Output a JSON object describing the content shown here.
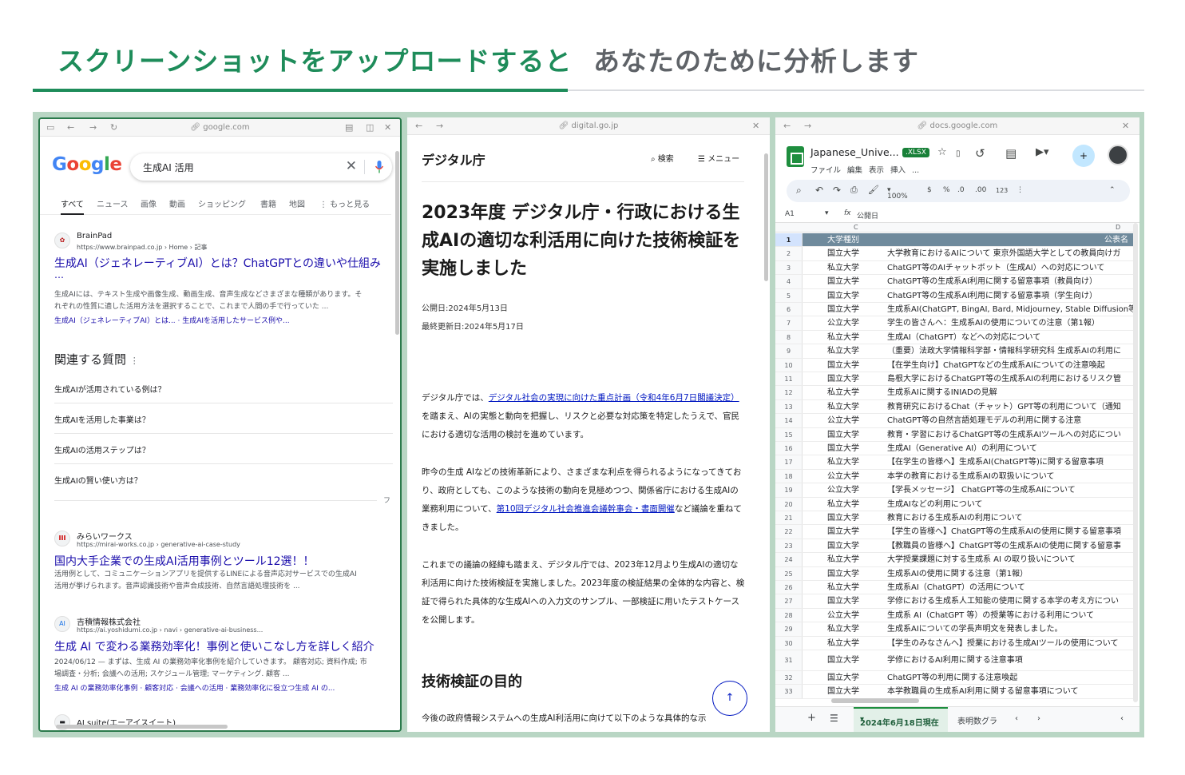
{
  "header": {
    "active_tab": "スクリーンショットをアップロードすると",
    "inactive_tab": "あなたのために分析します"
  },
  "panel_google": {
    "url": "google.com",
    "logo": [
      "G",
      "o",
      "o",
      "g",
      "l",
      "e"
    ],
    "query": "生成AI 活用",
    "nav": [
      "すべて",
      "ニュース",
      "画像",
      "動画",
      "ショッピング",
      "書籍",
      "地図",
      "⋮ もっと見る"
    ],
    "results": [
      {
        "site": "BrainPad",
        "crumb": "https://www.brainpad.co.jp › Home › 記事",
        "title": "生成AI（ジェネレーティブAI）とは？ChatGPTとの違いや仕組み",
        "ellipsis": "…",
        "snippet1": "生成AIには、テキスト生成や画像生成、動画生成、音声生成などさまざまな種類があります。そ",
        "snippet2": "れぞれの性質に適した活用方法を選択することで、これまで人間の手で行っていた ...",
        "links": "生成AI（ジェネレーティブAI）とは... · 生成AIを活用したサービス例や..."
      },
      {
        "site": "みらいワークス",
        "crumb": "https://mirai-works.co.jp › generative-ai-case-study",
        "title": "国内大手企業での生成AI活用事例とツール12選！！",
        "snippet1": "活用例として、コミュニケーションアプリを提供するLINEによる音声応対サービスでの生成AI",
        "snippet2": "活用が挙げられます。音声認識技術や音声合成技術、自然言語処理技術を ..."
      },
      {
        "site": "吉積情報株式会社",
        "crumb": "https://ai.yoshidumi.co.jp › navi › generative-ai-business...",
        "title": "生成 AI で変わる業務効率化！事例と使いこなし方を詳しく紹介",
        "snippet1": "2024/06/12 — まずは、生成 AI の業務効率化事例を紹介していきます。 顧客対応; 資料作成; 市",
        "snippet2": "場調査・分析; 会議への活用; スケジュール管理; マーケティング. 顧客 ...",
        "links": "生成 AI の業務効率化事例 · 顧客対応 · 会議への活用 · 業務効率化に役立つ生成 AI の..."
      },
      {
        "site": "AI suite(エーアイスイート)"
      }
    ],
    "paa_title": "関連する質問",
    "paa": [
      "生成AIが活用されている例は？",
      "生成AIを活用した事業は？",
      "生成AIの活用ステップは？",
      "生成AIの賢い使い方は？"
    ],
    "feedback": "フ"
  },
  "panel_digital": {
    "url": "digital.go.jp",
    "site_name": "デジタル庁",
    "search_label": "検索",
    "menu_label": "メニュー",
    "title": "2023年度 デジタル庁・行政における生成AIの適切な利活用に向けた技術検証を実施しました",
    "published": "公開日:2024年5月13日",
    "updated": "最終更新日:2024年5月17日",
    "p1_a": "デジタル庁では、",
    "p1_link": "デジタル社会の実現に向けた重点計画（令和4年6月7日閣議決定）",
    "p1_b": "を踏まえ、AIの実態と動向を把握し、リスクと必要な対応策を特定したうえで、官民における適切な活用の検討を進めています。",
    "p2_a": "昨今の生成 AIなどの技術革新により、さまざまな利点を得られるようになってきており、政府としても、このような技術の動向を見極めつつ、関係省庁における生成AIの業務利用について、",
    "p2_link": "第10回デジタル社会推進会議幹事会・書面開催",
    "p2_b": "など議論を重ねてきました。",
    "p3": "これまでの議論の経緯も踏まえ、デジタル庁では、2023年12月より生成AIの適切な利活用に向けた技術検証を実施しました。2023年度の検証結果の全体的な内容と、検証で得られた具体的な生成AIへの入力文のサンプル、一部検証に用いたテストケースを公開します。",
    "h2": "技術検証の目的",
    "last_line": "今後の政府情報システムへの生成AI利活用に向けて以下のような具体的な示"
  },
  "panel_sheets": {
    "url": "docs.google.com",
    "doc_name": "Japanese_Unive...",
    "badge": ".XLSX",
    "menu": [
      "ファイル",
      "編集",
      "表示",
      "挿入",
      "..."
    ],
    "zoom": "100%",
    "toolbar_items": [
      "$",
      "%",
      ".0",
      ".00",
      "123"
    ],
    "cell_ref": "A1",
    "formula": "公開日",
    "col_c": "C",
    "col_d": "D",
    "rows": [
      {
        "n": "1",
        "a": "大学種別",
        "b": "公表名"
      },
      {
        "n": "2",
        "a": "国立大学",
        "b": "大学教育におけるAIについて 東京外国語大学としての教員向けガ"
      },
      {
        "n": "3",
        "a": "私立大学",
        "b": "ChatGPT等のAIチャットボット（生成AI）への対応について"
      },
      {
        "n": "4",
        "a": "国立大学",
        "b": "ChatGPT等の生成系AI利用に関する留意事項（教員向け）"
      },
      {
        "n": "5",
        "a": "国立大学",
        "b": "ChatGPT等の生成系AI利用に関する留意事項（学生向け）"
      },
      {
        "n": "6",
        "a": "国立大学",
        "b": "生成系AI(ChatGPT, BingAI, Bard, Midjourney, Stable Diffusion等)"
      },
      {
        "n": "7",
        "a": "公立大学",
        "b": "学生の皆さんへ：生成系AIの使用についての注意（第1報）"
      },
      {
        "n": "8",
        "a": "私立大学",
        "b": "生成AI（ChatGPT）などへの対応について"
      },
      {
        "n": "9",
        "a": "私立大学",
        "b": "（重要）法政大学情報科学部・情報科学研究科 生成系AIの利用に"
      },
      {
        "n": "10",
        "a": "国立大学",
        "b": "【在学生向け】ChatGPTなどの生成系AIについての注意喚起"
      },
      {
        "n": "11",
        "a": "国立大学",
        "b": "島根大学におけるChatGPT等の生成系AIの利用におけるリスク管"
      },
      {
        "n": "12",
        "a": "私立大学",
        "b": "生成系AIに関するINIADの見解"
      },
      {
        "n": "13",
        "a": "私立大学",
        "b": "教育研究におけるChat（チャット）GPT等の利用について（通知"
      },
      {
        "n": "14",
        "a": "公立大学",
        "b": "ChatGPT等の自然言語処理モデルの利用に関する注意"
      },
      {
        "n": "15",
        "a": "国立大学",
        "b": "教育・学習におけるChatGPT等の生成系AIツールへの対応につい"
      },
      {
        "n": "16",
        "a": "国立大学",
        "b": "生成AI（Generative AI）の利用について"
      },
      {
        "n": "17",
        "a": "私立大学",
        "b": "【在学生の皆様へ】生成系AI(ChatGPT等)に関する留意事項"
      },
      {
        "n": "18",
        "a": "公立大学",
        "b": "本学の教育における生成系AIの取扱いについて"
      },
      {
        "n": "19",
        "a": "公立大学",
        "b": "【学長メッセージ】 ChatGPT等の生成系AIについて"
      },
      {
        "n": "20",
        "a": "私立大学",
        "b": "生成AIなどの利用について"
      },
      {
        "n": "21",
        "a": "国立大学",
        "b": "教育における生成系AIの利用について"
      },
      {
        "n": "22",
        "a": "国立大学",
        "b": "【学生の皆様へ】ChatGPT等の生成系AIの使用に関する留意事項"
      },
      {
        "n": "23",
        "a": "国立大学",
        "b": "【教職員の皆様へ】ChatGPT等の生成系AIの使用に関する留意事"
      },
      {
        "n": "24",
        "a": "私立大学",
        "b": "大学授業課題に対する生成系 AI の取り扱いについて"
      },
      {
        "n": "25",
        "a": "国立大学",
        "b": "生成系AIの使用に関する注意（第1報）"
      },
      {
        "n": "26",
        "a": "私立大学",
        "b": "生成系AI（ChatGPT）の活用について"
      },
      {
        "n": "27",
        "a": "国立大学",
        "b": "学修における生成系人工知能の使用に関する本学の考え方につい"
      },
      {
        "n": "28",
        "a": "公立大学",
        "b": "生成系 AI（ChatGPT 等）の授業等における利用について"
      },
      {
        "n": "29",
        "a": "私立大学",
        "b": "生成系AIについての学長声明文を発表しました。"
      },
      {
        "n": "30",
        "a": "私立大学",
        "b": "【学生のみなさんへ】授業における生成AIツールの使用について"
      },
      {
        "n": "31",
        "a": "国立大学",
        "b": "学修におけるAI利用に関する注意事項"
      },
      {
        "n": "32",
        "a": "国立大学",
        "b": "ChatGPT等の利用に関する注意喚起"
      },
      {
        "n": "33",
        "a": "国立大学",
        "b": "本学教職員の生成系AI利用に関する留意事項について"
      }
    ],
    "sheet_tab": "2024年6月18日現在",
    "sheet_tab2": "表明数グラ"
  }
}
